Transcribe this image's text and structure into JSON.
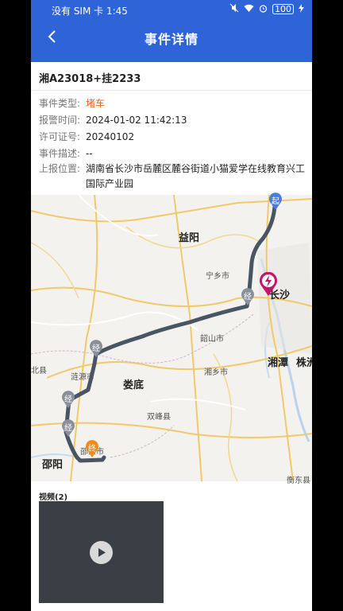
{
  "status_bar": {
    "carrier": "没有 SIM 卡 1:45",
    "battery": "100"
  },
  "header": {
    "title": "事件详情"
  },
  "event": {
    "plate": "湘A23018+挂2233",
    "fields": [
      {
        "label": "事件类型:",
        "value": "堵车",
        "highlight": "#e0672b"
      },
      {
        "label": "报警时间:",
        "value": "2024-01-02 11:42:13"
      },
      {
        "label": "许可证号:",
        "value": "20240102"
      },
      {
        "label": "事件描述:",
        "value": "--"
      },
      {
        "label": "上报位置:",
        "value": "湖南省长沙市岳麓区麓谷街道小猫爱学在线教育兴工国际产业园"
      }
    ]
  },
  "map": {
    "labels": {
      "yiyang": "益阳",
      "ningxiang": "宁乡市",
      "changsha": "长沙",
      "shaoshan": "韶山市",
      "xiangtan": "湘潭",
      "zhuzhou": "株洲",
      "xiangxiang": "湘乡市",
      "lianyuan": "涟源市",
      "loudi": "娄底",
      "shuangfeng": "双峰县",
      "shaodong": "邵东市",
      "shaoyang": "邵阳",
      "hengdong": "衡东县",
      "left_county": "北县"
    },
    "markers": {
      "start": "起",
      "via": "经",
      "end": "终"
    },
    "route_color": "#4a5563",
    "alert_color": "#c0166e"
  },
  "video": {
    "title": "视频(2)"
  }
}
